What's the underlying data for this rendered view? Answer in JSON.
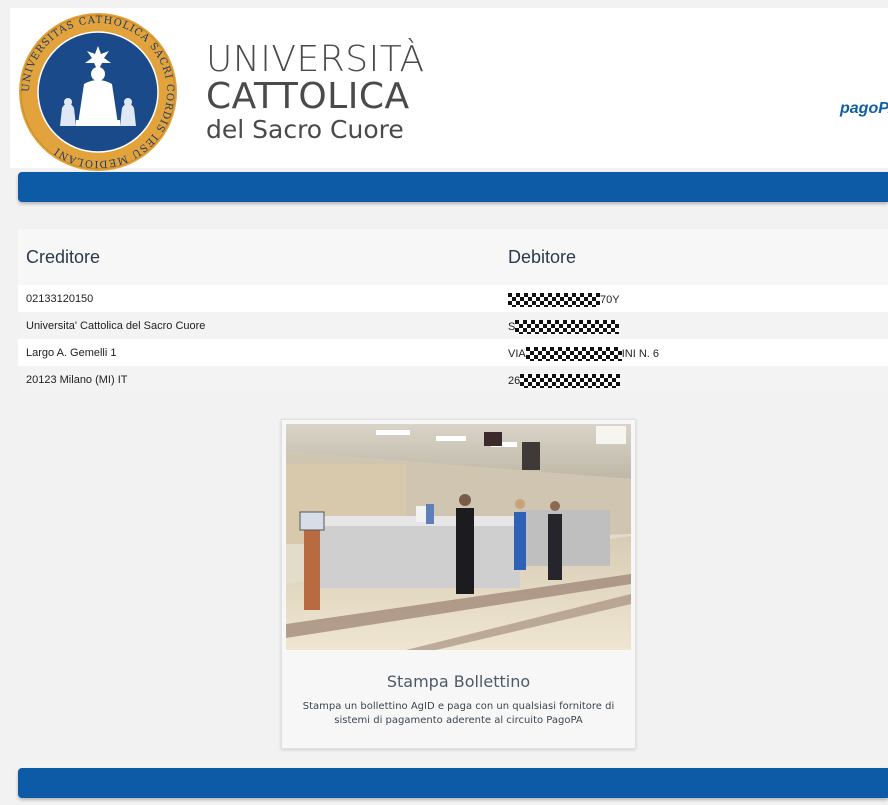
{
  "header": {
    "university": {
      "line1": "UNIVERSITÀ",
      "line2": "CATTOLICA",
      "line3": "del Sacro Cuore"
    },
    "seal_text": "UNIVERSITAS CATHOLICA SACRI CORDIS IESU MEDIOLANI",
    "pagopa_logo_text": "pagoPA"
  },
  "info": {
    "creditor_heading": "Creditore",
    "debtor_heading": "Debitore",
    "creditor_rows": [
      "02133120150",
      "Universita' Cattolica del Sacro Cuore",
      "Largo A. Gemelli 1",
      "20123 Milano (MI) IT"
    ],
    "debtor_rows": [
      {
        "prefix": "",
        "suffix": "70Y"
      },
      {
        "prefix": "S",
        "suffix": ""
      },
      {
        "prefix": "VIA",
        "suffix": "INI N. 6"
      },
      {
        "prefix": "26",
        "suffix": ""
      }
    ]
  },
  "card": {
    "title": "Stampa Bollettino",
    "description": "Stampa un bollettino AgID e paga con un qualsiasi fornitore di sistemi di pagamento aderente al circuito PagoPA"
  },
  "colors": {
    "primary_bar": "#0d5aa7",
    "seal_gold": "#e3a33c",
    "seal_blue": "#1a4a8a"
  }
}
